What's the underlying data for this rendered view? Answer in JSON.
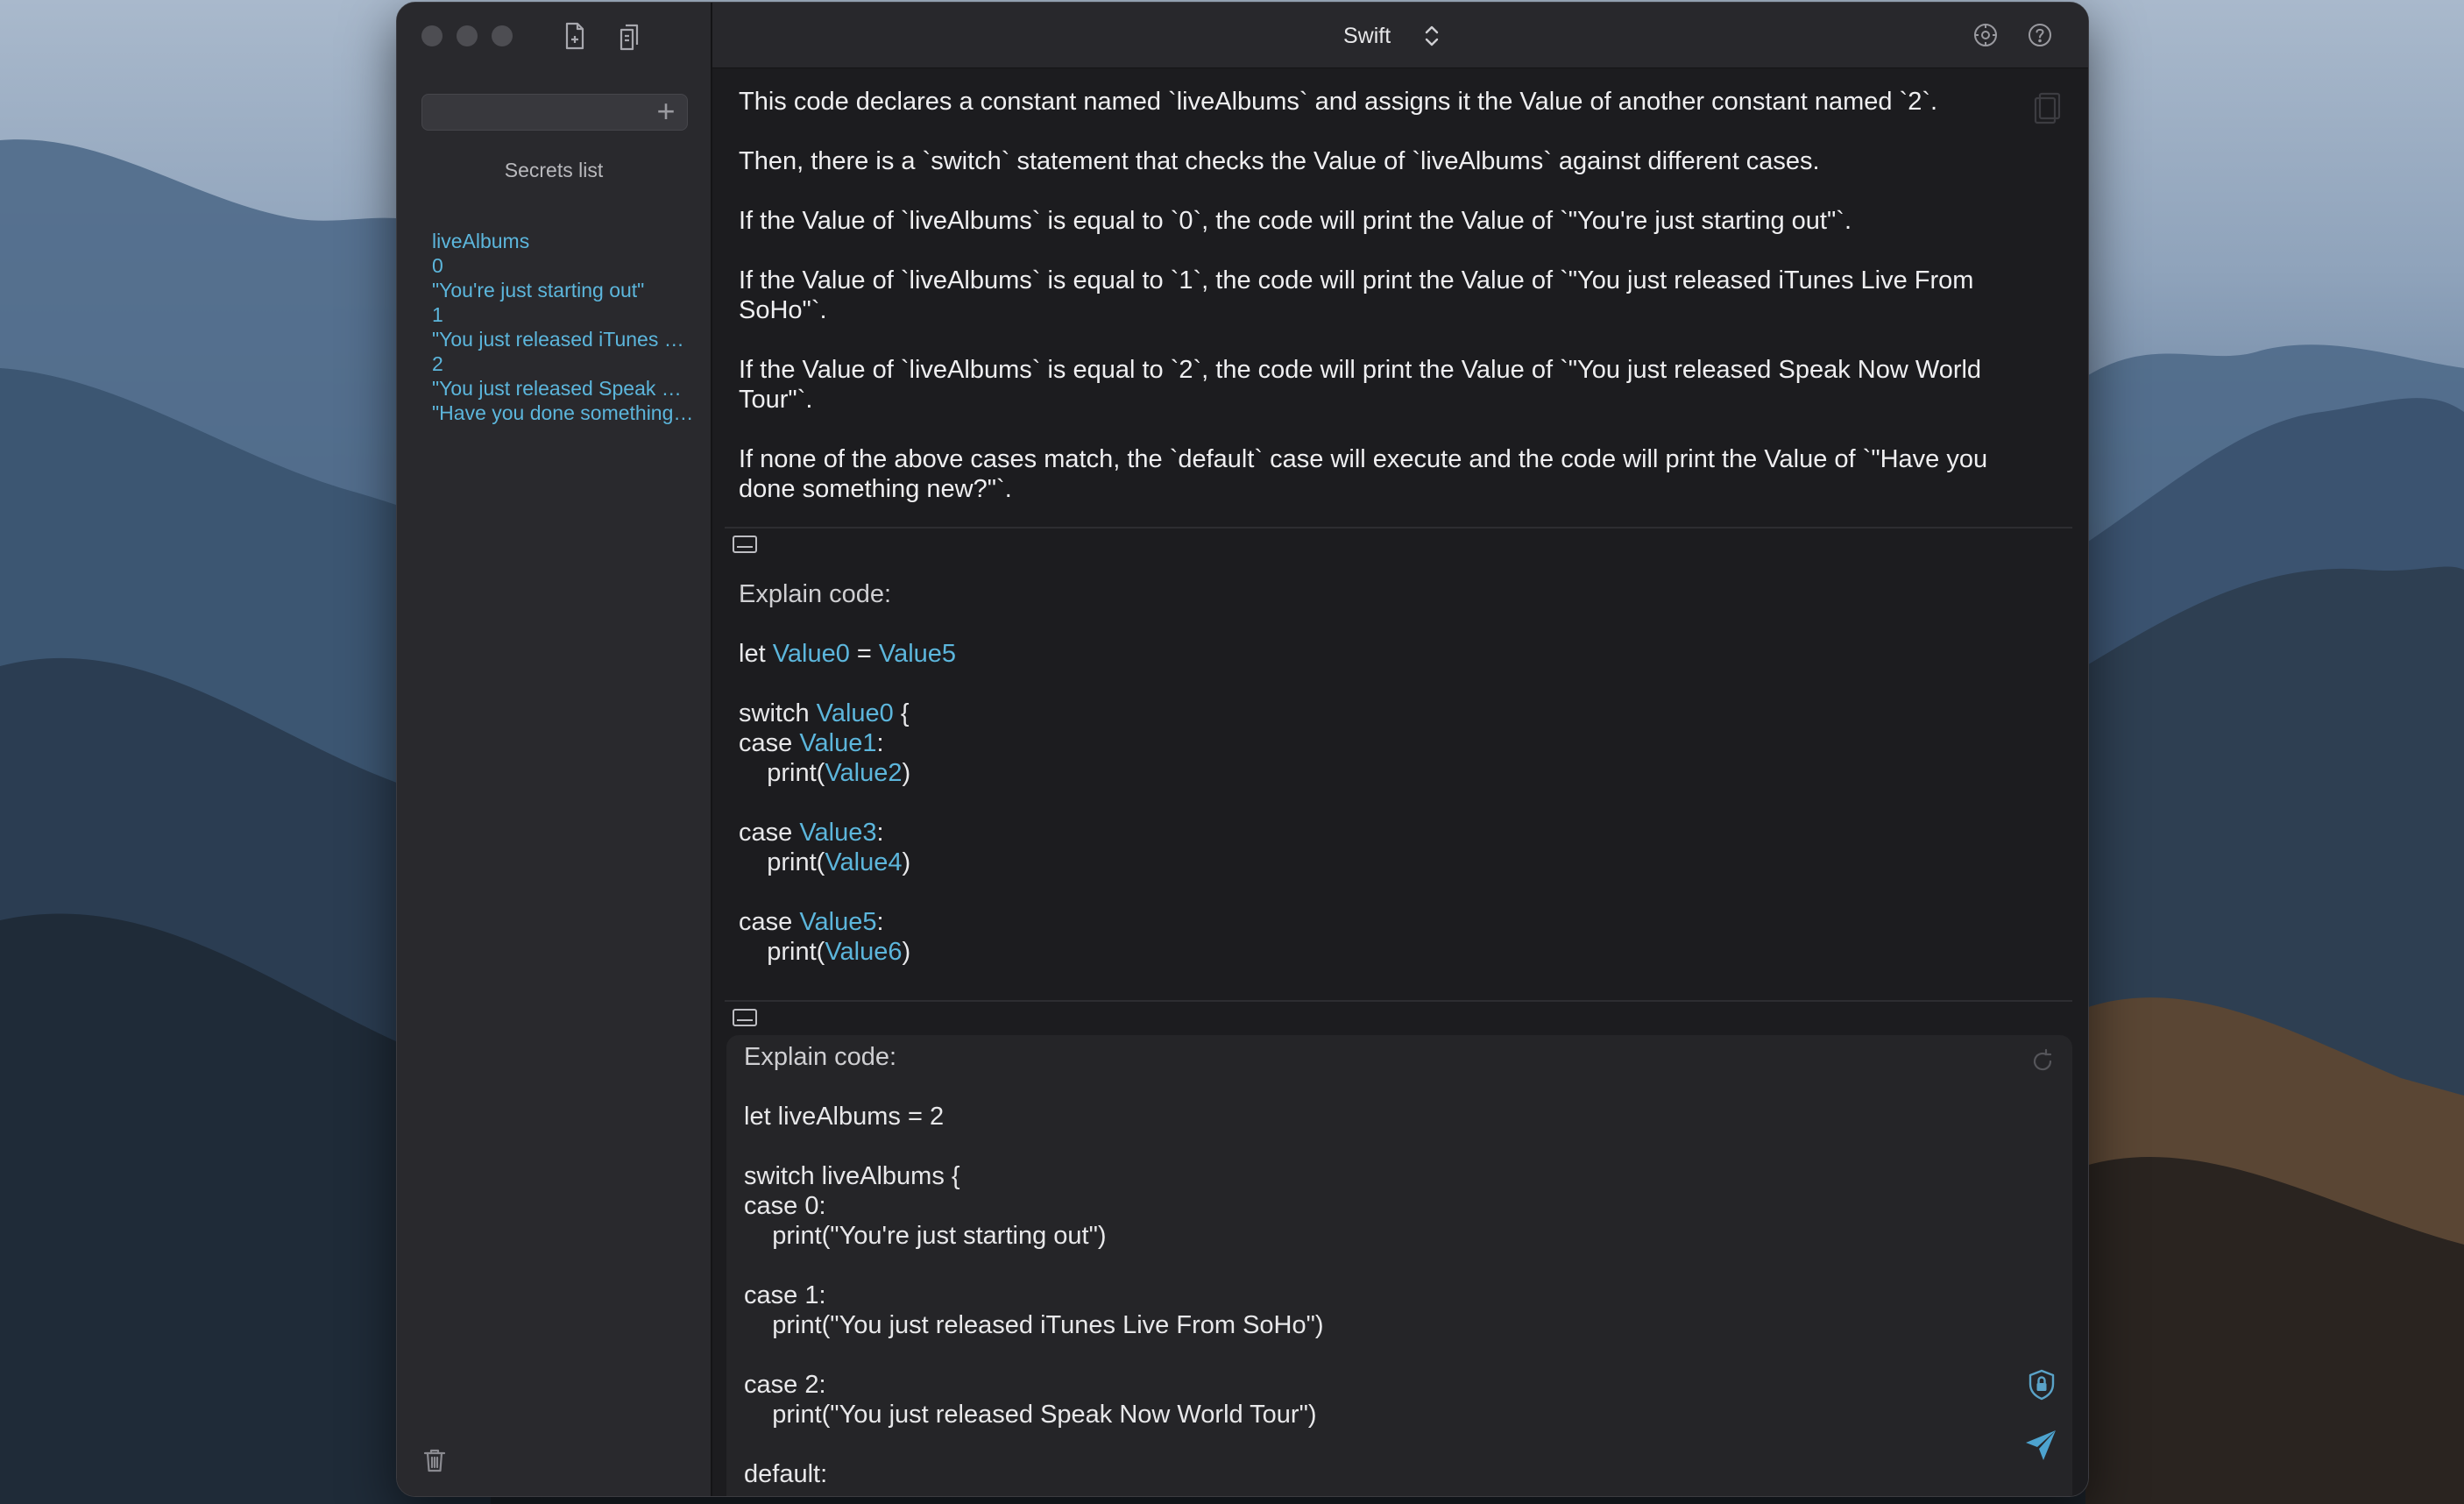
{
  "app": {
    "language": "Swift",
    "colors": {
      "accent": "#5cb6dc",
      "window_bg": "#1c1c1f",
      "sidebar_bg": "#29292d",
      "titlebar_bg": "#28282c"
    }
  },
  "sidebar": {
    "search_placeholder": "",
    "secrets_title": "Secrets list",
    "secrets": [
      "liveAlbums",
      "0",
      "\"You're just starting out\"",
      "1",
      "\"You just released iTunes Live From SoHo\"",
      "2",
      "\"You just released Speak Now World Tour\"",
      "\"Have you done something new?\""
    ],
    "icons": [
      "new-document-icon",
      "copy-document-icon",
      "plus-icon",
      "trash-icon"
    ]
  },
  "response": {
    "lines": [
      "This code declares a constant named `liveAlbums` and assigns it the Value of another constant named `2`.",
      "Then, there is a `switch` statement that checks the Value of `liveAlbums` against different cases.",
      "If the Value of `liveAlbums` is equal to `0`, the code will print the Value of `\"You're just starting out\"`.",
      "If the Value of `liveAlbums` is equal to `1`, the code will print the Value of `\"You just released iTunes Live From",
      "SoHo\"`.",
      "If the Value of `liveAlbums` is equal to `2`, the code will print the Value of `\"You just released Speak Now World",
      "Tour\"`.",
      "If none of the above cases match, the `default` case will execute and the code will print the Value of `\"Have you",
      "done something new?\"`."
    ]
  },
  "obfuscated": {
    "label": "Explain code:",
    "lines": [
      {
        "pre": "let ",
        "tok1": "Value0",
        "mid": " = ",
        "tok2": "Value5",
        "post": ""
      },
      {
        "pre": "switch ",
        "tok1": "Value0",
        "mid": " {",
        "tok2": "",
        "post": ""
      },
      {
        "pre": "case ",
        "tok1": "Value1",
        "mid": ":",
        "tok2": "",
        "post": ""
      },
      {
        "pre": "    print(",
        "tok1": "Value2",
        "mid": ")",
        "tok2": "",
        "post": ""
      },
      {
        "pre": "case ",
        "tok1": "Value3",
        "mid": ":",
        "tok2": "",
        "post": ""
      },
      {
        "pre": "    print(",
        "tok1": "Value4",
        "mid": ")",
        "tok2": "",
        "post": ""
      },
      {
        "pre": "case ",
        "tok1": "Value5",
        "mid": ":",
        "tok2": "",
        "post": ""
      },
      {
        "pre": "    print(",
        "tok1": "Value6",
        "mid": ")",
        "tok2": "",
        "post": ""
      }
    ]
  },
  "input": {
    "label": "Explain code:",
    "lines": [
      "let liveAlbums = 2",
      "switch liveAlbums {",
      "case 0:",
      "    print(\"You're just starting out\")",
      "case 1:",
      "    print(\"You just released iTunes Live From SoHo\")",
      "case 2:",
      "    print(\"You just released Speak Now World Tour\")",
      "default:"
    ]
  }
}
